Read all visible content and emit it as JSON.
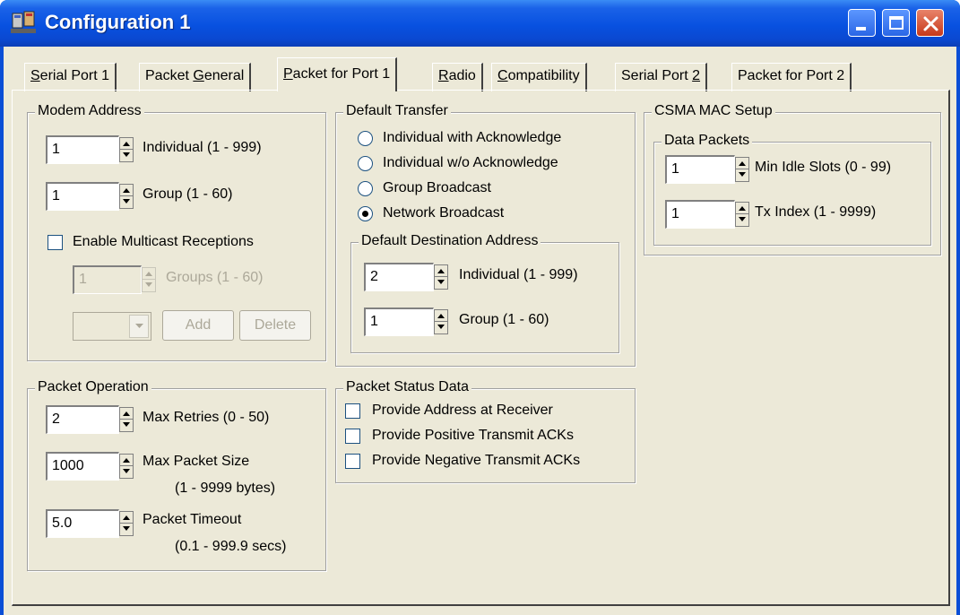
{
  "window": {
    "title": "Configuration 1"
  },
  "tabs": [
    {
      "pre": "",
      "u": "S",
      "post": "erial Port 1"
    },
    {
      "pre": "Packet ",
      "u": "G",
      "post": "eneral"
    },
    {
      "pre": "",
      "u": "P",
      "post": "acket for Port 1"
    },
    {
      "pre": "",
      "u": "R",
      "post": "adio"
    },
    {
      "pre": "",
      "u": "C",
      "post": "ompatibility"
    },
    {
      "pre": "Serial Port ",
      "u": "2",
      "post": ""
    },
    {
      "pre": "Packet for Port 2",
      "u": "",
      "post": ""
    }
  ],
  "modem_address": {
    "title": "Modem Address",
    "individual": {
      "value": "1",
      "label": "Individual  (1 - 999)"
    },
    "group": {
      "value": "1",
      "label": "Group  (1 - 60)"
    },
    "multicast": {
      "label": "Enable Multicast Receptions",
      "checked": false
    },
    "groups": {
      "value": "1",
      "label": "Groups  (1 - 60)"
    },
    "add_label": "Add",
    "delete_label": "Delete"
  },
  "default_transfer": {
    "title": "Default Transfer",
    "options": [
      {
        "label": "Individual with Acknowledge",
        "selected": false
      },
      {
        "label": "Individual w/o Acknowledge",
        "selected": false
      },
      {
        "label": "Group Broadcast",
        "selected": false
      },
      {
        "label": "Network Broadcast",
        "selected": true
      }
    ],
    "destination": {
      "title": "Default Destination Address",
      "individual": {
        "value": "2",
        "label": "Individual  (1 - 999)"
      },
      "group": {
        "value": "1",
        "label": "Group  (1 - 60)"
      }
    }
  },
  "csma": {
    "title": "CSMA MAC Setup",
    "data_packets": {
      "title": "Data Packets",
      "min_idle": {
        "value": "1",
        "label": "Min Idle Slots  (0 - 99)"
      },
      "tx_index": {
        "value": "1",
        "label": "Tx Index  (1 - 9999)"
      }
    }
  },
  "packet_operation": {
    "title": "Packet Operation",
    "max_retries": {
      "value": "2",
      "label": "Max Retries  (0 - 50)"
    },
    "max_packet_size": {
      "value": "1000",
      "label": "Max Packet Size",
      "range": "(1 - 9999 bytes)"
    },
    "packet_timeout": {
      "value": "5.0",
      "label": "Packet Timeout",
      "range": "(0.1 - 999.9 secs)"
    }
  },
  "packet_status": {
    "title": "Packet Status Data",
    "options": [
      {
        "label": "Provide Address at Receiver",
        "checked": false
      },
      {
        "label": "Provide Positive Transmit ACKs",
        "checked": false
      },
      {
        "label": "Provide Negative Transmit ACKs",
        "checked": false
      }
    ]
  }
}
